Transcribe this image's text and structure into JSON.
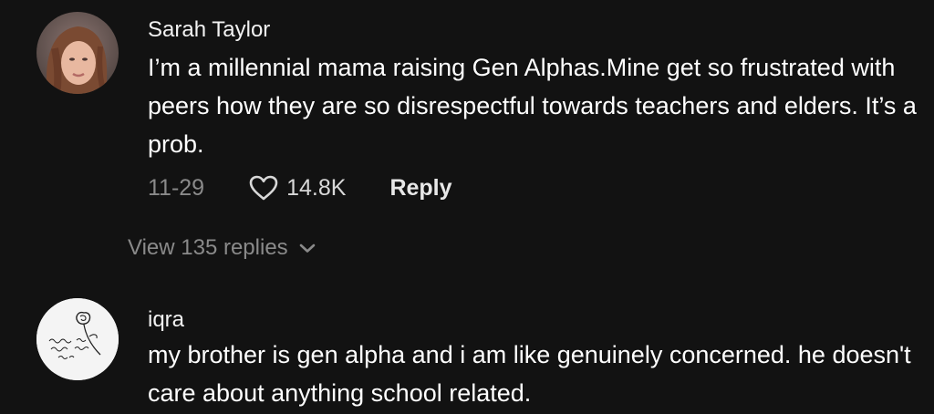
{
  "comments": [
    {
      "author": "Sarah Taylor",
      "text": "I’m a millennial mama raising Gen Alphas.Mine get so frustrated with peers how they are so disrespectful towards teachers and elders. It’s a prob.",
      "date": "11-29",
      "likes": "14.8K",
      "reply_label": "Reply",
      "view_replies_label": "View 135 replies",
      "avatar_icon": "person-photo-avatar"
    },
    {
      "author": "iqra",
      "text": "my brother is gen alpha and i am like genuinely concerned. he doesn't care about anything school related.",
      "avatar_icon": "rose-sketch-avatar",
      "avatar_lettering": "Sometimes you just jump and hope it's not a day"
    }
  ],
  "icons": {
    "like": "heart-outline-icon",
    "expand": "chevron-down-icon"
  },
  "colors": {
    "background": "#121212",
    "muted_text": "#8a8a8a",
    "primary_text": "#ffffff"
  }
}
